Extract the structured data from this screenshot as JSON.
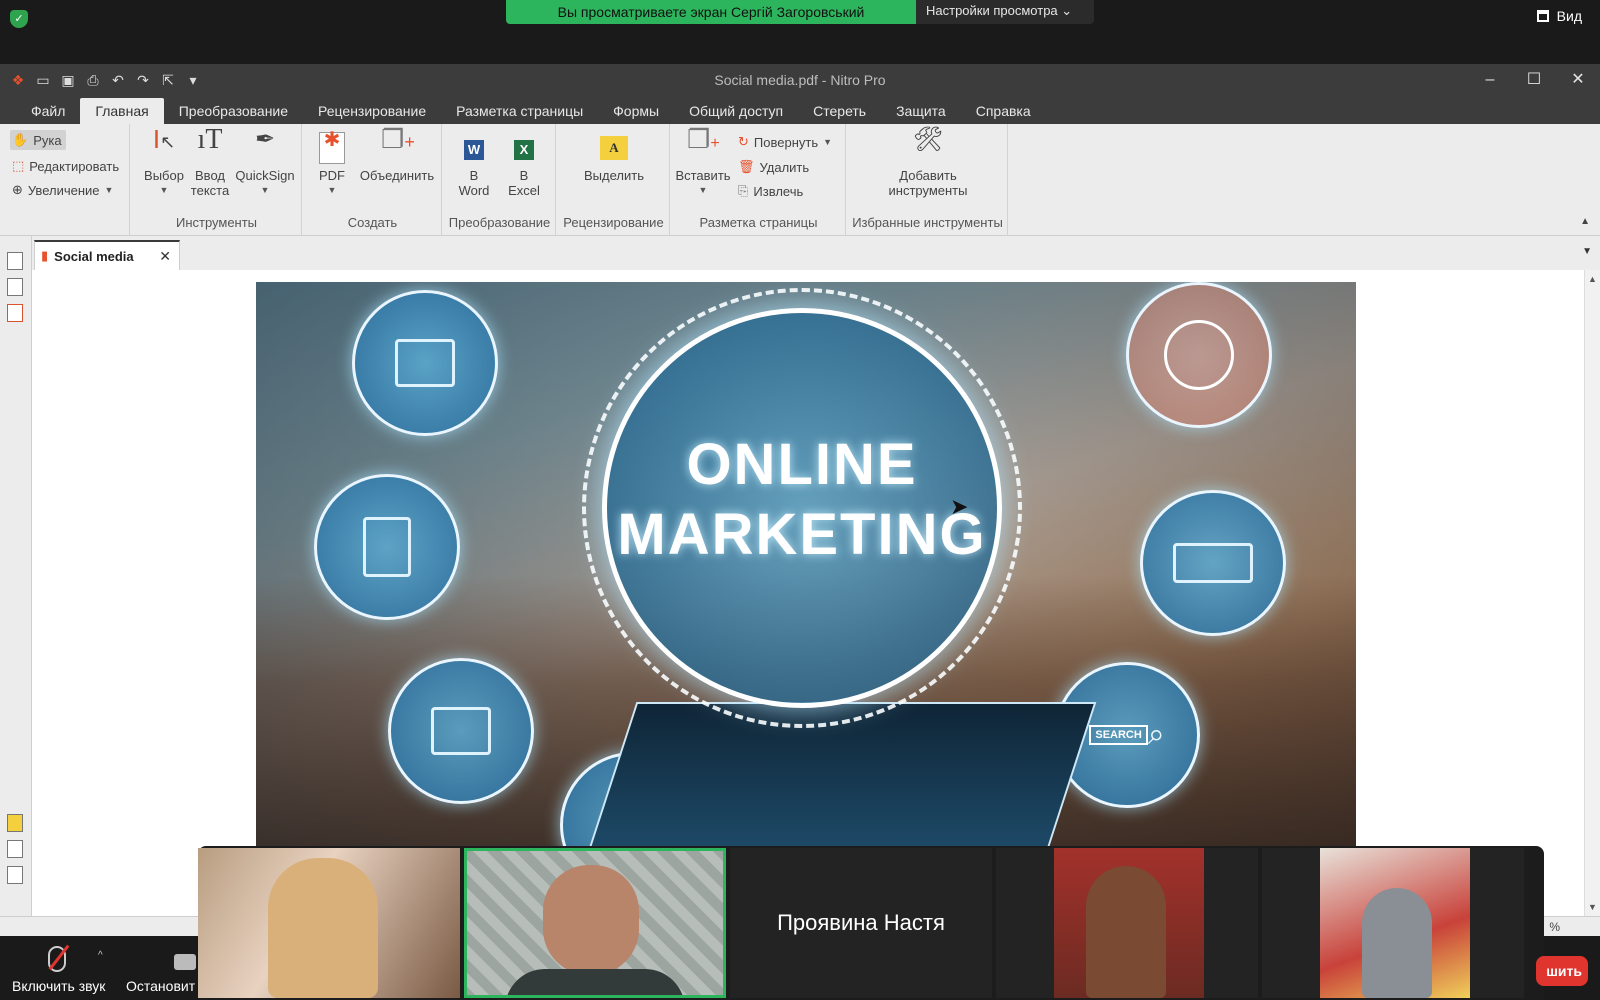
{
  "zoom": {
    "share_banner": "Вы просматриваете экран Сергій Загоровський",
    "view_settings": "Настройки просмотра",
    "view_button": "Вид",
    "mute_label": "Включить звук",
    "video_label": "Остановит",
    "end_label": "шить"
  },
  "window": {
    "title": "Social media.pdf - Nitro Pro"
  },
  "menu": {
    "items": [
      "Файл",
      "Главная",
      "Преобразование",
      "Рецензирование",
      "Разметка страницы",
      "Формы",
      "Общий доступ",
      "Стереть",
      "Защита",
      "Справка"
    ],
    "active_index": 1
  },
  "ribbon": {
    "nav": {
      "hand": "Рука",
      "edit": "Редактировать",
      "zoom": "Увеличение"
    },
    "tools": {
      "label": "Инструменты",
      "select": "Выбор",
      "type_text_1": "Ввод",
      "type_text_2": "текста",
      "quicksign": "QuickSign"
    },
    "create": {
      "label": "Создать",
      "pdf": "PDF",
      "combine": "Объединить"
    },
    "convert": {
      "label": "Преобразование",
      "to": "В",
      "word": "Word",
      "excel": "Excel"
    },
    "review": {
      "label": "Рецензирование",
      "highlight": "Выделить"
    },
    "page_layout": {
      "label": "Разметка страницы",
      "insert": "Вставить",
      "rotate": "Повернуть",
      "delete": "Удалить",
      "extract": "Извлечь"
    },
    "favorites": {
      "label": "Избранные инструменты",
      "add_1": "Добавить",
      "add_2": "инструменты"
    }
  },
  "document": {
    "tab_label": "Social media",
    "headline_1": "ONLINE",
    "headline_2": "MARKETING",
    "search_label": "SEARCH",
    "zoom_pct": "%"
  },
  "participants": [
    {
      "kind": "video"
    },
    {
      "kind": "video",
      "active": true
    },
    {
      "kind": "name",
      "name": "Проявина Настя"
    },
    {
      "kind": "video"
    },
    {
      "kind": "video"
    }
  ],
  "colors": {
    "zoom_green": "#2db55d",
    "nitro_dark": "#3c3c3c",
    "ribbon_bg": "#ececec",
    "end_red": "#e0342f"
  }
}
